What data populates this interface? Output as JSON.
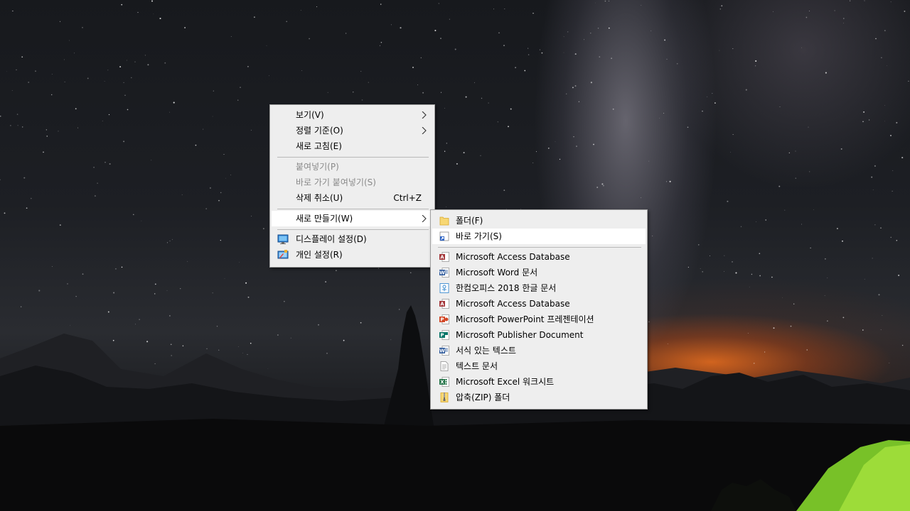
{
  "context_menu": {
    "items": [
      {
        "label": "보기(V)"
      },
      {
        "label": "정렬 기준(O)"
      },
      {
        "label": "새로 고침(E)"
      },
      {
        "label": "붙여넣기(P)"
      },
      {
        "label": "바로 가기 붙여넣기(S)"
      },
      {
        "label": "삭제 취소(U)",
        "shortcut": "Ctrl+Z"
      },
      {
        "label": "새로 만들기(W)"
      },
      {
        "label": "디스플레이 설정(D)",
        "icon": "display-icon"
      },
      {
        "label": "개인 설정(R)",
        "icon": "personalize-icon"
      }
    ]
  },
  "new_submenu": {
    "items": [
      {
        "label": "폴더(F)",
        "icon": "folder-icon"
      },
      {
        "label": "바로 가기(S)",
        "icon": "shortcut-icon"
      },
      {
        "label": "Microsoft Access Database",
        "icon": "access-icon"
      },
      {
        "label": "Microsoft Word 문서",
        "icon": "word-icon"
      },
      {
        "label": "한컴오피스 2018 한글 문서",
        "icon": "hwp-icon"
      },
      {
        "label": "Microsoft Access Database",
        "icon": "access-icon"
      },
      {
        "label": "Microsoft PowerPoint 프레젠테이션",
        "icon": "powerpoint-icon"
      },
      {
        "label": "Microsoft Publisher Document",
        "icon": "publisher-icon"
      },
      {
        "label": "서식 있는 텍스트",
        "icon": "rtf-icon"
      },
      {
        "label": "텍스트 문서",
        "icon": "text-doc-icon"
      },
      {
        "label": "Microsoft Excel 워크시트",
        "icon": "excel-icon"
      },
      {
        "label": "압축(ZIP) 폴더",
        "icon": "zip-folder-icon"
      }
    ]
  },
  "colors": {
    "menu_bg": "#eeeeee",
    "highlight_bg": "#ffffff",
    "disabled_text": "#8a8a8a",
    "separator": "#b9b9b9"
  }
}
